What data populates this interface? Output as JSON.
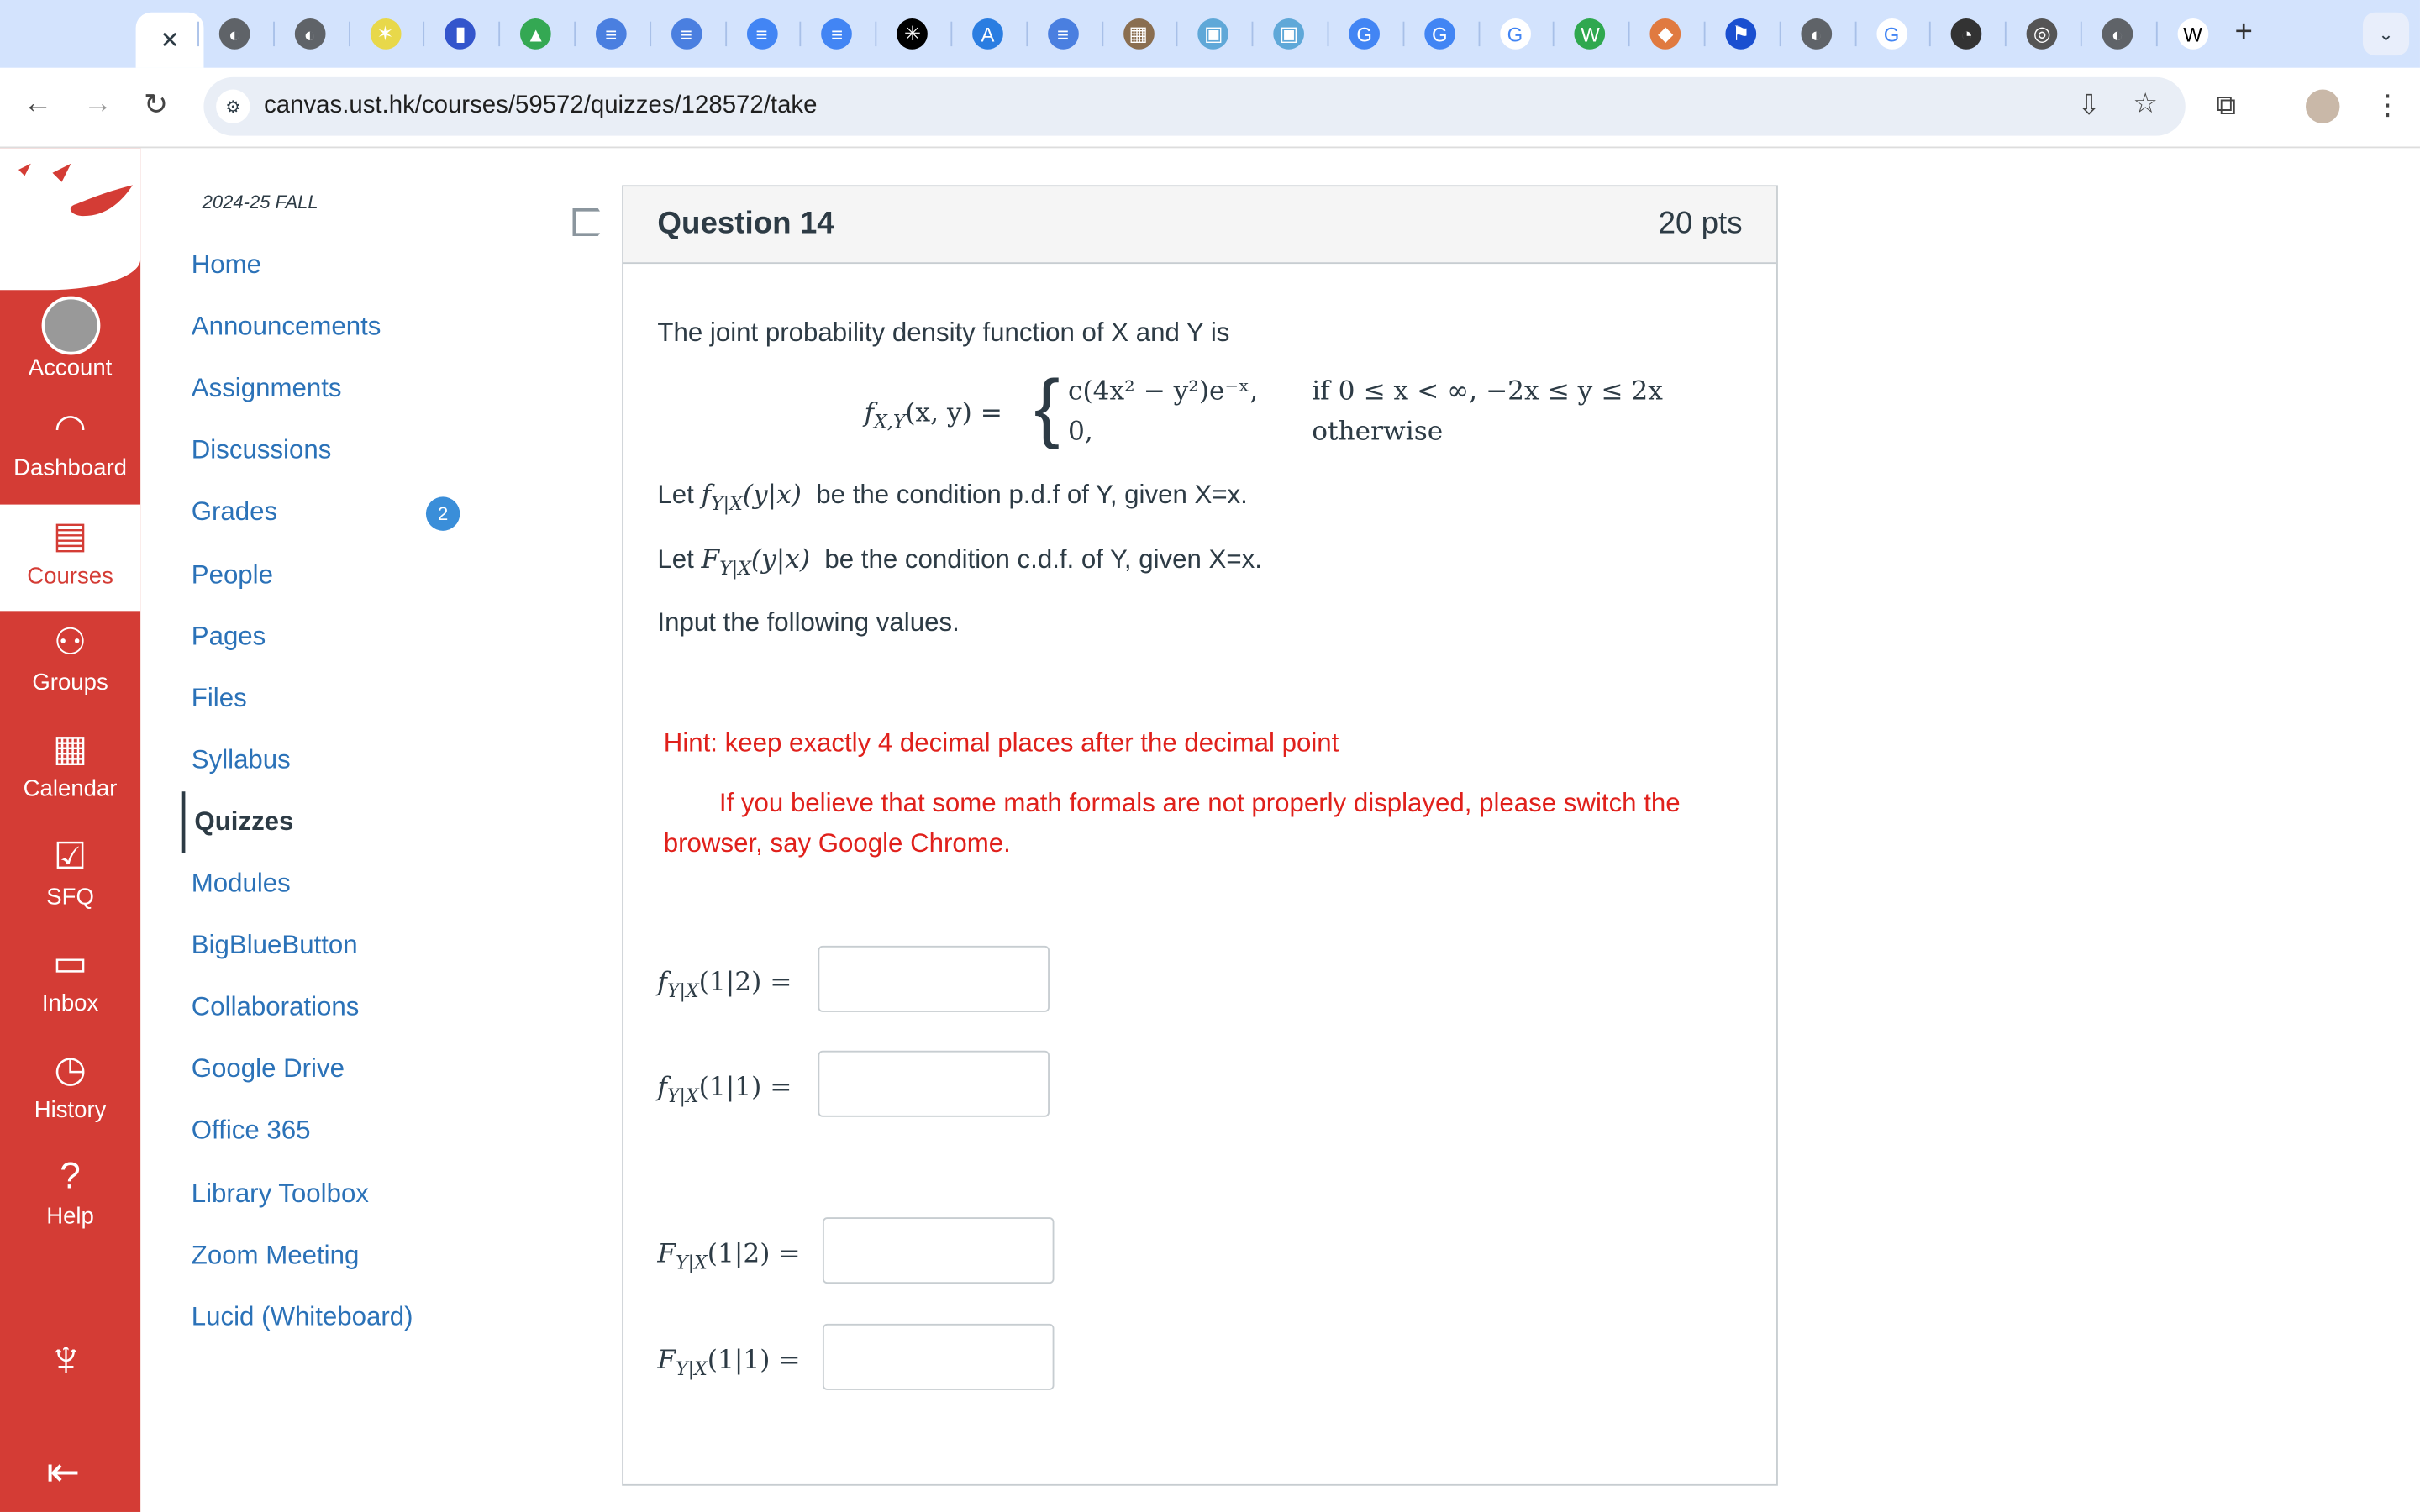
{
  "browser": {
    "tabs": [
      "close",
      "globe",
      "globe",
      "spider",
      "speech",
      "drive",
      "docs-circle",
      "docs-circle",
      "docs",
      "docs",
      "black-star",
      "appstore",
      "docs-circle",
      "photo",
      "bili",
      "bili",
      "google-circle",
      "google-circle",
      "google",
      "w-green",
      "cube",
      "flag",
      "globe",
      "google",
      "clock",
      "chrome",
      "globe",
      "wikipedia"
    ],
    "active_tab_close": "✕",
    "new_tab": "+",
    "url": "canvas.ust.hk/courses/59572/quizzes/128572/take"
  },
  "global_nav": {
    "brand": "canvas",
    "items": [
      {
        "label": "Account",
        "icon": "avatar-icon"
      },
      {
        "label": "Dashboard",
        "icon": "dashboard-icon"
      },
      {
        "label": "Courses",
        "icon": "courses-icon"
      },
      {
        "label": "Groups",
        "icon": "groups-icon"
      },
      {
        "label": "Calendar",
        "icon": "calendar-icon"
      },
      {
        "label": "SFQ",
        "icon": "checkbox-icon"
      },
      {
        "label": "Inbox",
        "icon": "inbox-icon"
      },
      {
        "label": "History",
        "icon": "clock-icon"
      },
      {
        "label": "Help",
        "icon": "help-icon"
      }
    ],
    "active": "Courses",
    "colors": {
      "nav": "#d43c35",
      "link": "#2b72b8",
      "hint": "#e0201b"
    }
  },
  "course_nav": {
    "term": "2024-25 FALL",
    "items": [
      "Home",
      "Announcements",
      "Assignments",
      "Discussions",
      "Grades",
      "People",
      "Pages",
      "Files",
      "Syllabus",
      "Quizzes",
      "Modules",
      "BigBlueButton",
      "Collaborations",
      "Google Drive",
      "Office 365",
      "Library Toolbox",
      "Zoom Meeting",
      "Lucid (Whiteboard)"
    ],
    "active": "Quizzes",
    "grades_badge": "2"
  },
  "question": {
    "title": "Question 14",
    "points": "20 pts",
    "intro": "The joint probability density function of X and Y is",
    "formula": {
      "lhs": "f",
      "lhs_sub": "X,Y",
      "lhs_args": "(x, y) =",
      "case1": "c(4x² − y²)e⁻ˣ,",
      "cond1": "if 0 ≤ x < ∞, −2x ≤ y ≤ 2x",
      "case2": "0,",
      "cond2": "otherwise"
    },
    "let1_pre": "Let",
    "let1_math": "f",
    "let1_sub": "Y|X",
    "let1_args": "(y|x)",
    "let1_post": "be the condition p.d.f of Y, given X=x.",
    "let2_pre": "Let",
    "let2_math": "F",
    "let2_sub": "Y|X",
    "let2_args": "(y|x)",
    "let2_post": "be the condition c.d.f. of Y, given X=x.",
    "instruction": "Input the following values.",
    "hint": "Hint: keep exactly 4 decimal places after the decimal point",
    "note_line1": "If you believe that some math formals are not properly displayed, please switch the",
    "note_line2": "browser, say Google Chrome.",
    "inputs": [
      {
        "fn": "f",
        "sub": "Y|X",
        "args": "(1|2) =",
        "value": ""
      },
      {
        "fn": "f",
        "sub": "Y|X",
        "args": "(1|1) =",
        "value": ""
      },
      {
        "fn": "F",
        "sub": "Y|X",
        "args": "(1|2) =",
        "value": ""
      },
      {
        "fn": "F",
        "sub": "Y|X",
        "args": "(1|1) =",
        "value": ""
      }
    ]
  }
}
